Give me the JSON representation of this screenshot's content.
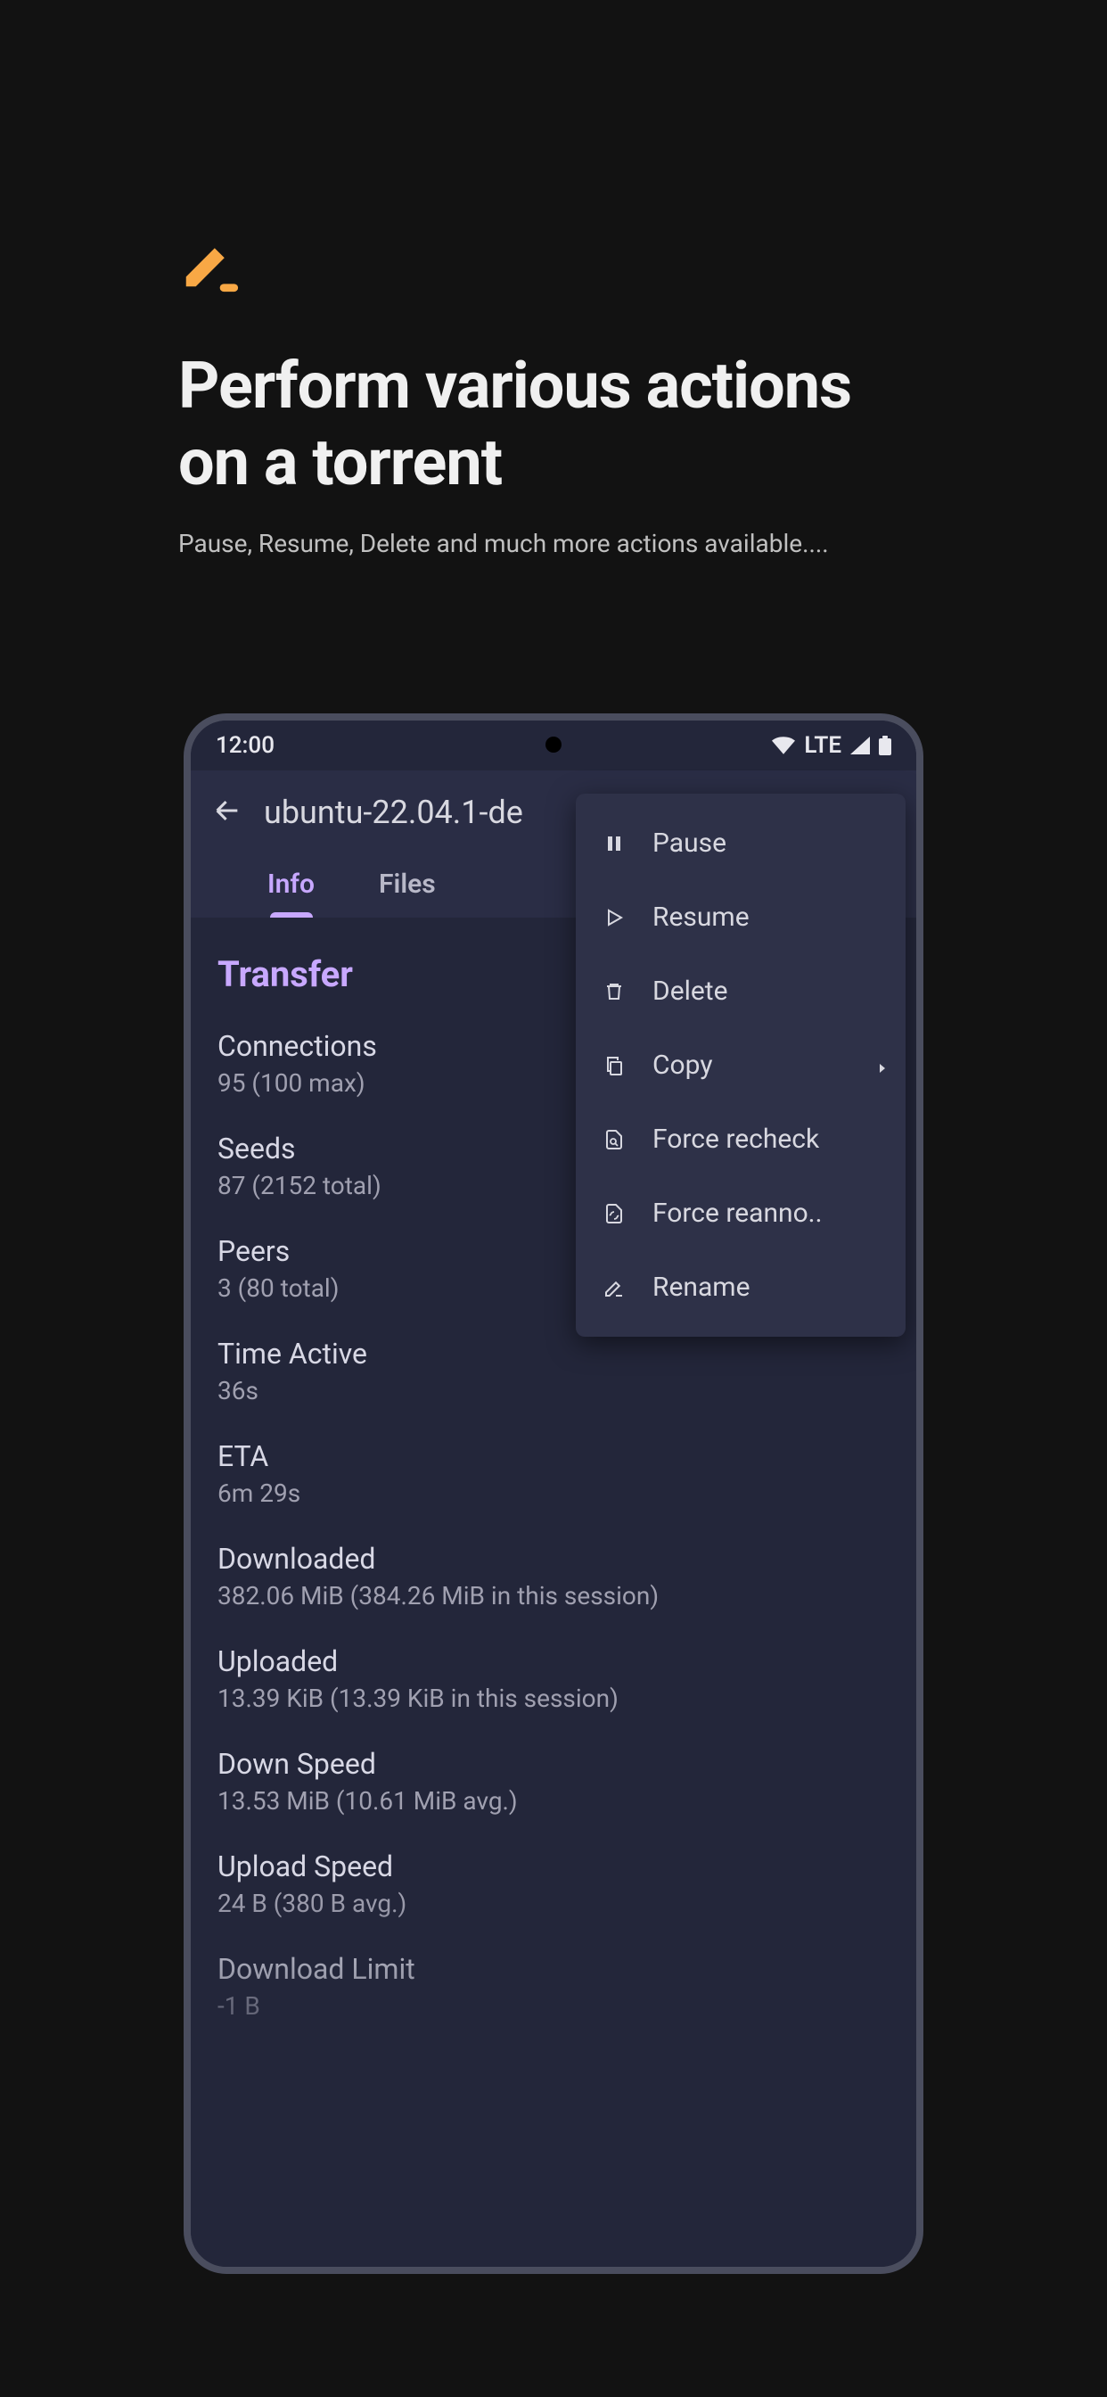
{
  "header": {
    "title": "Perform various actions on a torrent",
    "subtitle": "Pause, Resume, Delete and much more actions available...."
  },
  "statusbar": {
    "time": "12:00",
    "network": "LTE"
  },
  "appbar": {
    "title": "ubuntu-22.04.1-de"
  },
  "tabs": {
    "info": "Info",
    "files": "Files"
  },
  "section": {
    "title": "Transfer"
  },
  "rows": [
    {
      "label": "Connections",
      "value": "95 (100 max)"
    },
    {
      "label": "Seeds",
      "value": "87 (2152 total)"
    },
    {
      "label": "Peers",
      "value": "3 (80 total)"
    },
    {
      "label": "Time Active",
      "value": "36s"
    },
    {
      "label": "ETA",
      "value": "6m 29s"
    },
    {
      "label": "Downloaded",
      "value": "382.06 MiB (384.26 MiB in this session)"
    },
    {
      "label": "Uploaded",
      "value": "13.39 KiB (13.39 KiB in this session)"
    },
    {
      "label": "Down Speed",
      "value": "13.53 MiB (10.61 MiB avg.)"
    },
    {
      "label": "Upload Speed",
      "value": "24 B (380 B avg.)"
    },
    {
      "label": "Download Limit",
      "value": "-1 B"
    }
  ],
  "menu": {
    "pause": "Pause",
    "resume": "Resume",
    "delete": "Delete",
    "copy": "Copy",
    "force_recheck": "Force recheck",
    "force_reannounce": "Force reanno..",
    "rename": "Rename"
  }
}
